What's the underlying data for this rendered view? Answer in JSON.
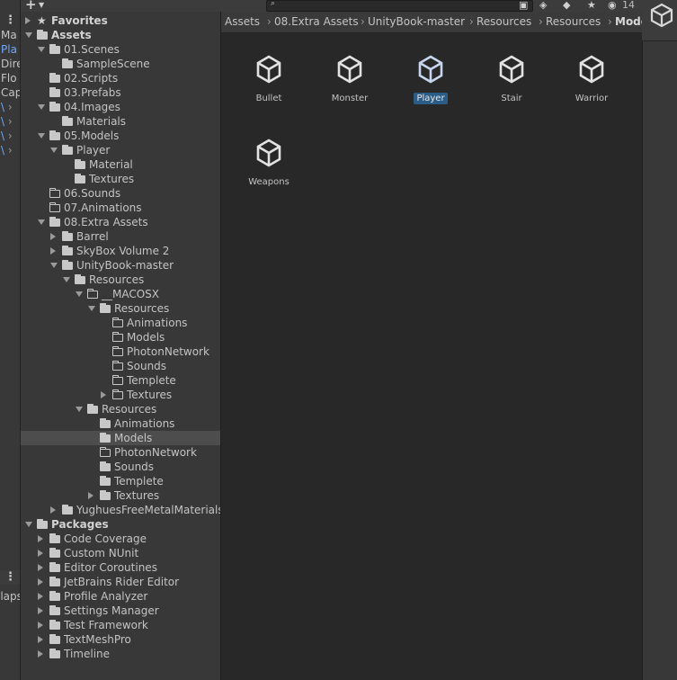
{
  "left_strip": {
    "rows": [
      {
        "text": "Ma",
        "selected": false
      },
      {
        "text": "Pla",
        "selected": true
      },
      {
        "text": "Dire",
        "selected": false
      },
      {
        "text": "Flo",
        "selected": false
      },
      {
        "text": "Cap",
        "selected": false
      }
    ],
    "collapse_text": "llaps"
  },
  "toolbar": {
    "add_label": "+",
    "hidden_count": "14"
  },
  "tree": {
    "rows": [
      {
        "label": "Favorites",
        "depth": 0,
        "arrow": "right",
        "icon": "star",
        "bold": true
      },
      {
        "label": "Assets",
        "depth": 0,
        "arrow": "down",
        "icon": "folder-filled",
        "bold": true
      },
      {
        "label": "01.Scenes",
        "depth": 1,
        "arrow": "down",
        "icon": "folder-filled"
      },
      {
        "label": "SampleScene",
        "depth": 2,
        "arrow": "none",
        "icon": "folder-filled"
      },
      {
        "label": "02.Scripts",
        "depth": 1,
        "arrow": "none",
        "icon": "folder-filled"
      },
      {
        "label": "03.Prefabs",
        "depth": 1,
        "arrow": "none",
        "icon": "folder-filled"
      },
      {
        "label": "04.Images",
        "depth": 1,
        "arrow": "down",
        "icon": "folder-filled"
      },
      {
        "label": "Materials",
        "depth": 2,
        "arrow": "none",
        "icon": "folder-filled"
      },
      {
        "label": "05.Models",
        "depth": 1,
        "arrow": "down",
        "icon": "folder-filled"
      },
      {
        "label": "Player",
        "depth": 2,
        "arrow": "down",
        "icon": "folder-filled"
      },
      {
        "label": "Material",
        "depth": 3,
        "arrow": "none",
        "icon": "folder-filled"
      },
      {
        "label": "Textures",
        "depth": 3,
        "arrow": "none",
        "icon": "folder-filled"
      },
      {
        "label": "06.Sounds",
        "depth": 1,
        "arrow": "none",
        "icon": "folder-empty"
      },
      {
        "label": "07.Animations",
        "depth": 1,
        "arrow": "none",
        "icon": "folder-empty"
      },
      {
        "label": "08.Extra Assets",
        "depth": 1,
        "arrow": "down",
        "icon": "folder-filled"
      },
      {
        "label": "Barrel",
        "depth": 2,
        "arrow": "right",
        "icon": "folder-filled"
      },
      {
        "label": "SkyBox Volume 2",
        "depth": 2,
        "arrow": "right",
        "icon": "folder-filled"
      },
      {
        "label": "UnityBook-master",
        "depth": 2,
        "arrow": "down",
        "icon": "folder-filled"
      },
      {
        "label": "Resources",
        "depth": 3,
        "arrow": "down",
        "icon": "folder-filled"
      },
      {
        "label": "__MACOSX",
        "depth": 4,
        "arrow": "down",
        "icon": "folder-empty"
      },
      {
        "label": "Resources",
        "depth": 5,
        "arrow": "down",
        "icon": "folder-filled"
      },
      {
        "label": "Animations",
        "depth": 6,
        "arrow": "none",
        "icon": "folder-empty"
      },
      {
        "label": "Models",
        "depth": 6,
        "arrow": "none",
        "icon": "folder-empty"
      },
      {
        "label": "PhotonNetwork",
        "depth": 6,
        "arrow": "none",
        "icon": "folder-empty"
      },
      {
        "label": "Sounds",
        "depth": 6,
        "arrow": "none",
        "icon": "folder-empty"
      },
      {
        "label": "Templete",
        "depth": 6,
        "arrow": "none",
        "icon": "folder-empty"
      },
      {
        "label": "Textures",
        "depth": 6,
        "arrow": "right",
        "icon": "folder-empty"
      },
      {
        "label": "Resources",
        "depth": 4,
        "arrow": "down",
        "icon": "folder-filled"
      },
      {
        "label": "Animations",
        "depth": 5,
        "arrow": "none",
        "icon": "folder-filled"
      },
      {
        "label": "Models",
        "depth": 5,
        "arrow": "none",
        "icon": "folder-filled",
        "selected": true
      },
      {
        "label": "PhotonNetwork",
        "depth": 5,
        "arrow": "none",
        "icon": "folder-empty"
      },
      {
        "label": "Sounds",
        "depth": 5,
        "arrow": "none",
        "icon": "folder-filled"
      },
      {
        "label": "Templete",
        "depth": 5,
        "arrow": "none",
        "icon": "folder-filled"
      },
      {
        "label": "Textures",
        "depth": 5,
        "arrow": "right",
        "icon": "folder-filled"
      },
      {
        "label": "YughuesFreeMetalMaterials",
        "depth": 2,
        "arrow": "right",
        "icon": "folder-filled"
      },
      {
        "label": "Packages",
        "depth": 0,
        "arrow": "down",
        "icon": "folder-filled",
        "bold": true
      },
      {
        "label": "Code Coverage",
        "depth": 1,
        "arrow": "right",
        "icon": "folder-filled"
      },
      {
        "label": "Custom NUnit",
        "depth": 1,
        "arrow": "right",
        "icon": "folder-filled"
      },
      {
        "label": "Editor Coroutines",
        "depth": 1,
        "arrow": "right",
        "icon": "folder-filled"
      },
      {
        "label": "JetBrains Rider Editor",
        "depth": 1,
        "arrow": "right",
        "icon": "folder-filled"
      },
      {
        "label": "Profile Analyzer",
        "depth": 1,
        "arrow": "right",
        "icon": "folder-filled"
      },
      {
        "label": "Settings Manager",
        "depth": 1,
        "arrow": "right",
        "icon": "folder-filled"
      },
      {
        "label": "Test Framework",
        "depth": 1,
        "arrow": "right",
        "icon": "folder-filled"
      },
      {
        "label": "TextMeshPro",
        "depth": 1,
        "arrow": "right",
        "icon": "folder-filled"
      },
      {
        "label": "Timeline",
        "depth": 1,
        "arrow": "right",
        "icon": "folder-filled"
      }
    ]
  },
  "breadcrumb": [
    "Assets",
    "08.Extra Assets",
    "UnityBook-master",
    "Resources",
    "Resources",
    "Mode"
  ],
  "assets": [
    {
      "label": "Bullet",
      "selected": false
    },
    {
      "label": "Monster",
      "selected": false
    },
    {
      "label": "Player",
      "selected": true
    },
    {
      "label": "Stair",
      "selected": false
    },
    {
      "label": "Warrior",
      "selected": false
    },
    {
      "label": "Weapons",
      "selected": false
    }
  ]
}
